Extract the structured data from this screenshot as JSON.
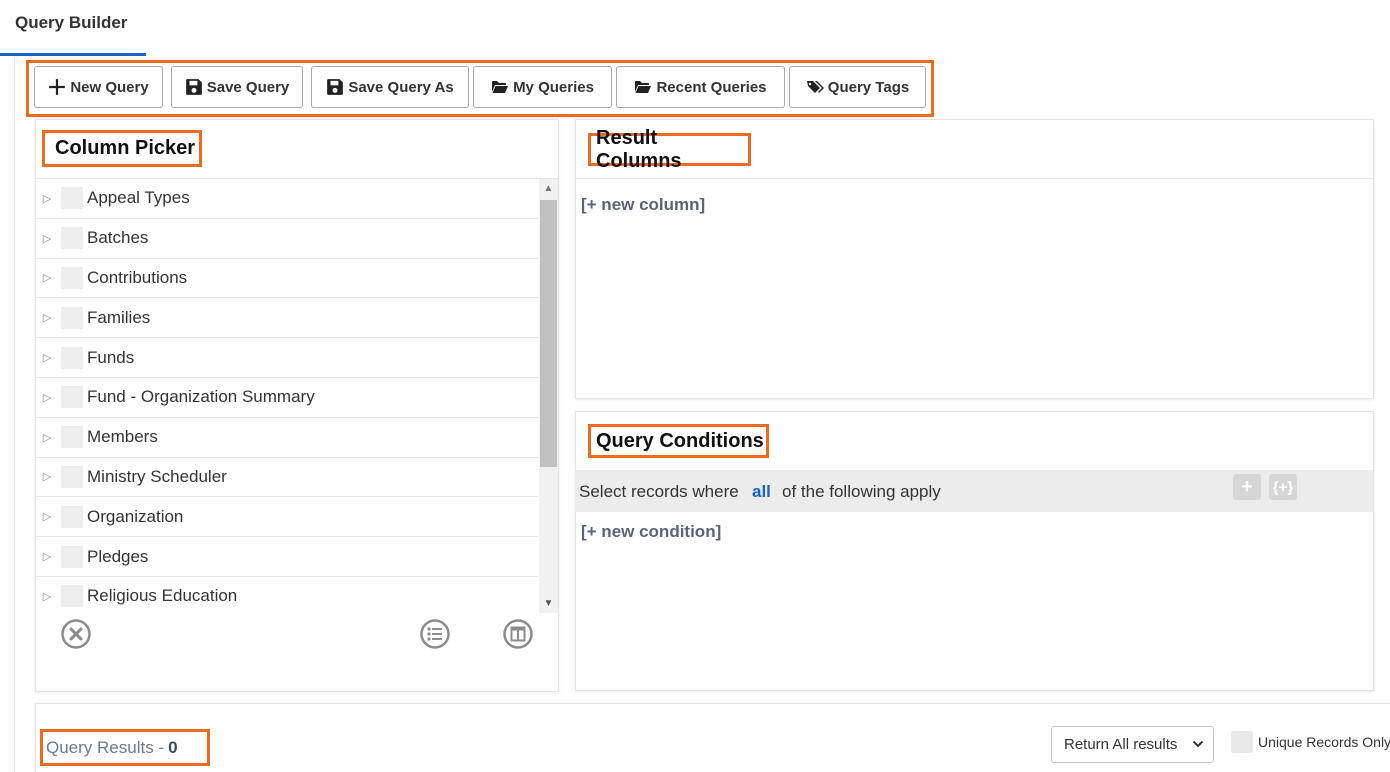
{
  "tabs": [
    {
      "label": "Query Builder"
    }
  ],
  "toolbar": {
    "buttons": [
      {
        "label": "New Query",
        "icon": "plus-icon"
      },
      {
        "label": "Save Query",
        "icon": "floppy-disk-icon"
      },
      {
        "label": "Save Query As",
        "icon": "floppy-disk-icon"
      },
      {
        "label": "My Queries",
        "icon": "folder-open-icon"
      },
      {
        "label": "Recent Queries",
        "icon": "folder-open-icon"
      },
      {
        "label": "Query Tags",
        "icon": "tags-icon"
      }
    ]
  },
  "column_picker": {
    "title": "Column Picker",
    "items": [
      {
        "label": "Appeal Types"
      },
      {
        "label": "Batches"
      },
      {
        "label": "Contributions"
      },
      {
        "label": "Families"
      },
      {
        "label": "Funds"
      },
      {
        "label": "Fund - Organization Summary"
      },
      {
        "label": "Members"
      },
      {
        "label": "Ministry Scheduler"
      },
      {
        "label": "Organization"
      },
      {
        "label": "Pledges"
      },
      {
        "label": "Religious Education"
      }
    ],
    "footer_icons": [
      "clear-circle-x-icon",
      "list-circle-icon",
      "layout-circle-icon"
    ]
  },
  "result_columns": {
    "title": "Result Columns",
    "add_link": "[+ new column]"
  },
  "query_conditions": {
    "title": "Query Conditions",
    "prefix": "Select records where",
    "mode": "all",
    "suffix": "of the following apply",
    "add_button": "+",
    "group_button": "{+}",
    "add_link": "[+ new condition]"
  },
  "results": {
    "label": "Query Results -",
    "count": "0",
    "select_value": "Return All results",
    "unique_label": "Unique Records Only"
  },
  "colors": {
    "highlight": "#ec6b1f",
    "accent": "#1a63c9"
  }
}
